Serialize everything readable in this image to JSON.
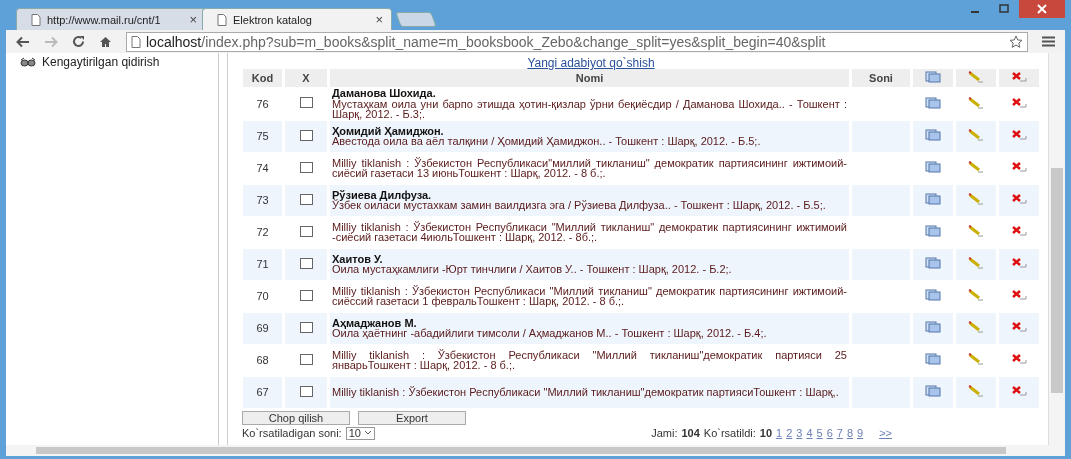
{
  "browser": {
    "tabs": [
      {
        "label": "http://www.mail.ru/cnt/1",
        "close": "×",
        "selected": false
      },
      {
        "label": "Elektron katalog",
        "close": "×",
        "selected": true
      }
    ],
    "address": {
      "host": "localhost",
      "path": "/index.php?sub=m_books&split_name=m_booksbook_Zebo&change_split=yes&split_begin=40&split"
    }
  },
  "sidebar": {
    "items": [
      {
        "label": "Kengaytirilgan qidirish"
      }
    ]
  },
  "add_link": "Yangi adabiyot qo`shish",
  "table": {
    "columns": [
      "Kod",
      "X",
      "Nomi",
      "Soni"
    ],
    "rows": [
      {
        "kod": "76",
        "checked": false,
        "author": "Даманова Шохида.",
        "title": "Мустаҳкам оила уни барпо этишда ҳотин-қизлар ўрни беқиёсдир / Даманова Шохида.. - Тошкент : Шарқ, 2012. - Б.3;."
      },
      {
        "kod": "75",
        "checked": false,
        "author": "Ҳомидий Ҳамиджон.",
        "title": "Авестода оила ва аёл талқини / Ҳомидий Ҳамиджон.. - Тошкент : Шарқ, 2012. - Б.5;."
      },
      {
        "kod": "74",
        "checked": false,
        "title": "Milliy tiklanish : Ўзбекистон Республикаси\"миллий тикланиш\" демократик партиясининг ижтимоий-сиёсий газетаси 13 июньТошкент : Шарқ, 2012. - 8 б.;."
      },
      {
        "kod": "73",
        "checked": false,
        "author": "Рўзиева Дилфуза.",
        "title": "Ўзбек оиласи мустахкам замин ваилдизга эга / Рўзиева Дилфуза.. - Тошкент : Шарқ, 2012. - Б.5;."
      },
      {
        "kod": "72",
        "checked": false,
        "title": "Milliy tiklanish : Ўзбекистон Республикаси \"Миллий тикланиш\" демократик партиясининг ижтимоий -сиёсий газетаси 4июльТошкент : Шарқ, 2012. - 8б.;."
      },
      {
        "kod": "71",
        "checked": false,
        "author": "Хаитов У.",
        "title": "Оила мустаҳкамлиги -Юрт тинчлиги / Хаитов У.. - Тошкент : Шарқ, 2012. - Б.2;."
      },
      {
        "kod": "70",
        "checked": false,
        "title": "Milliy tiklanish : Ўзбекистон Республикаси \"Миллий тикланиш\" демократик партиясининг ижтимоий-сиёссий газетаси 1 февральТошкент : Шарқ, 2012. - 8 б.;."
      },
      {
        "kod": "69",
        "checked": false,
        "author": "Аҳмаджанов М.",
        "title": "Оила ҳаётнинг -абадийлиги тимсоли / Аҳмаджанов М.. - Тошкент : Шарқ, 2012. - Б.4;."
      },
      {
        "kod": "68",
        "checked": false,
        "title": "Milliy tiklanish : Ўзбекистон Республикаси \"Миллий тикланиш\"демократик партияси 25 январьТошкент : Шарқ, 2012. - 8 б.;."
      },
      {
        "kod": "67",
        "checked": false,
        "title": "Milliy tiklanish : Ўзбекистон Республикаси \"Миллий тикланиш\"демократик партиясиТошкент : Шарқ,."
      }
    ]
  },
  "buttons": [
    "Chop qilish",
    "Export"
  ],
  "footer": {
    "per_page_label": "Ko`rsatiladigan soni:",
    "per_page": "10",
    "total_label": "Jami:",
    "total": "104",
    "shown_label": "Ko`rsatildi:",
    "shown": "10",
    "pages": [
      "1",
      "2",
      "3",
      "4",
      "5",
      "6",
      "7",
      "8",
      "9"
    ],
    "next": ">>"
  }
}
